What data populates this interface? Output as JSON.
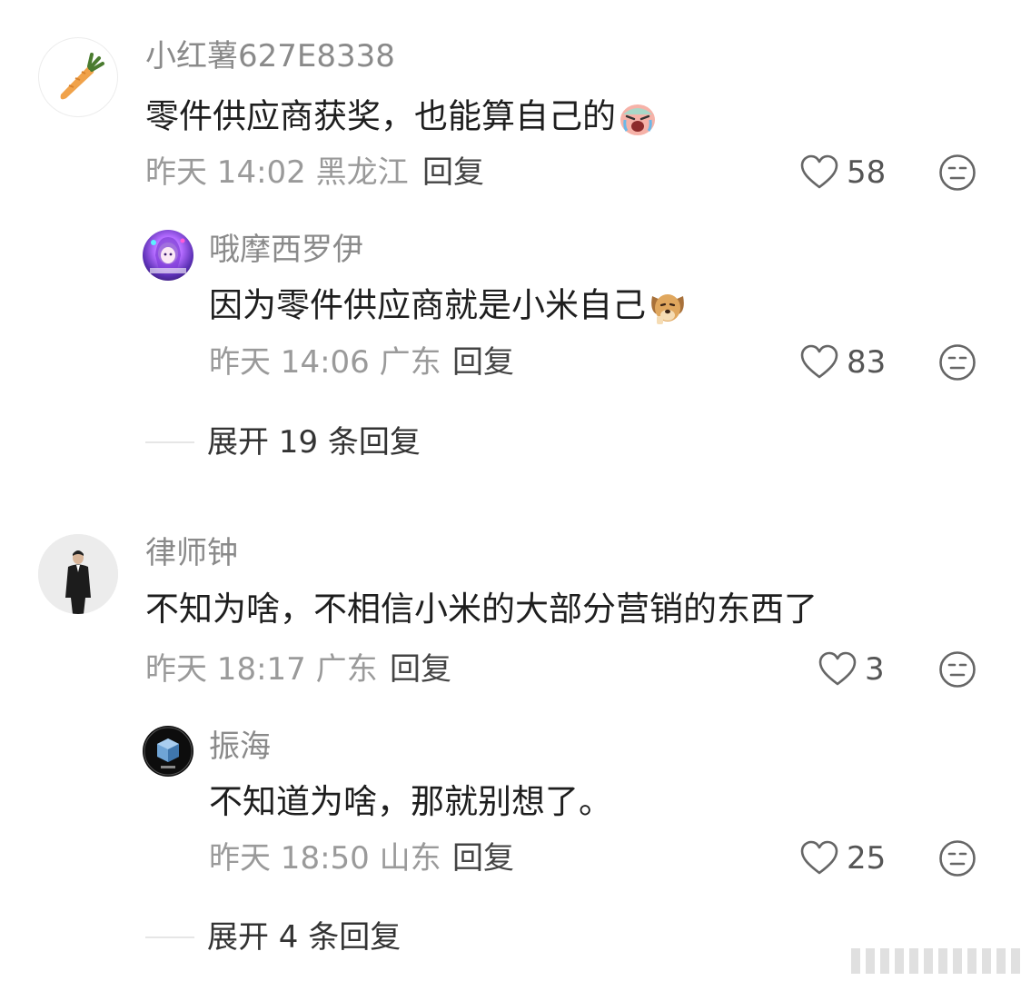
{
  "comments": [
    {
      "username": "小红薯627E8338",
      "content": "零件供应商获奖，也能算自己的",
      "time": "昨天 14:02",
      "location": "黑龙江",
      "reply_label": "回复",
      "likes": "58",
      "avatar": "carrot-avatar",
      "emoji": "crying-face-emoji",
      "replies": [
        {
          "username": "哦摩西罗伊",
          "content": "因为零件供应商就是小米自己",
          "time": "昨天 14:06",
          "location": "广东",
          "reply_label": "回复",
          "likes": "83",
          "avatar": "anime-girl-avatar",
          "emoji": "dog-face-emoji"
        }
      ],
      "expand_label": "展开 19 条回复"
    },
    {
      "username": "律师钟",
      "content": "不知为啥，不相信小米的大部分营销的东西了",
      "time": "昨天 18:17",
      "location": "广东",
      "reply_label": "回复",
      "likes": "3",
      "avatar": "man-in-suit-avatar",
      "replies": [
        {
          "username": "振海",
          "content": "不知道为啥，那就别想了。",
          "time": "昨天 18:50",
          "location": "山东",
          "reply_label": "回复",
          "likes": "25",
          "avatar": "blue-cube-avatar"
        }
      ],
      "expand_label": "展开 4 条回复"
    }
  ],
  "icons": {
    "like": "heart-icon",
    "dislike": "neutral-face-icon"
  },
  "colors": {
    "username": "#8a8a8a",
    "meta": "#9a9a9a",
    "content": "#1e1e1e"
  }
}
